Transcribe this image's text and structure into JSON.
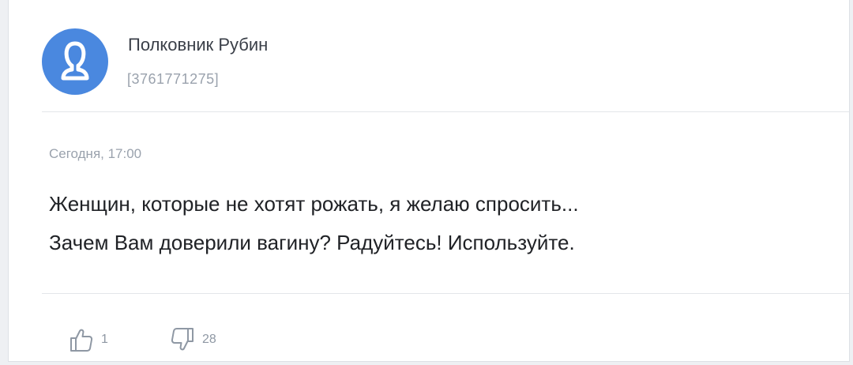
{
  "post": {
    "author": {
      "name": "Полковник Рубин",
      "id": "[3761771275]",
      "avatar_icon": "user-silhouette-icon",
      "avatar_color": "#4a88df"
    },
    "timestamp": "Сегодня, 17:00",
    "text_lines": [
      "Женщин, которые не хотят рожать, я желаю спросить...",
      "Зачем Вам доверили вагину? Радуйтесь! Используйте."
    ],
    "actions": {
      "like": {
        "icon": "thumbs-up-icon",
        "count": "1"
      },
      "dislike": {
        "icon": "thumbs-down-icon",
        "count": "28"
      }
    }
  }
}
